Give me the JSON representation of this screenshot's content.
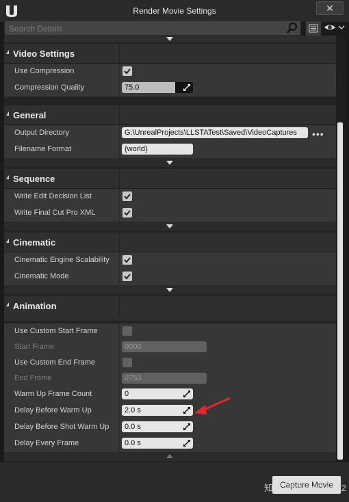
{
  "window": {
    "title": "Render Movie Settings",
    "close_glyph": "✕"
  },
  "search": {
    "placeholder": "Search Details"
  },
  "categories": [
    {
      "label": "Video Settings"
    },
    {
      "label": "General"
    },
    {
      "label": "Sequence"
    },
    {
      "label": "Cinematic"
    },
    {
      "label": "Animation"
    }
  ],
  "video": {
    "use_compression": {
      "label": "Use Compression",
      "checked": true
    },
    "compression_quality": {
      "label": "Compression Quality",
      "value": "75.0",
      "fraction": 0.75
    }
  },
  "general": {
    "output_directory": {
      "label": "Output Directory",
      "value": "G:\\UnrealProjects\\LLSTATest\\Saved\\VideoCaptures",
      "browse": "•••"
    },
    "filename_format": {
      "label": "Filename Format",
      "value": "{world}"
    }
  },
  "sequence": {
    "edl": {
      "label": "Write Edit Decision List",
      "checked": true
    },
    "fcp": {
      "label": "Write Final Cut Pro XML",
      "checked": true
    }
  },
  "cinematic": {
    "scalability": {
      "label": "Cinematic Engine Scalability",
      "checked": true
    },
    "mode": {
      "label": "Cinematic Mode",
      "checked": true
    }
  },
  "animation": {
    "use_custom_start": {
      "label": "Use Custom Start Frame",
      "checked": false
    },
    "start_frame": {
      "label": "Start Frame",
      "value": "0000"
    },
    "use_custom_end": {
      "label": "Use Custom End Frame",
      "checked": false
    },
    "end_frame": {
      "label": "End Frame",
      "value": "0750"
    },
    "warmup_count": {
      "label": "Warm Up Frame Count",
      "value": "0"
    },
    "delay_warmup": {
      "label": "Delay Before Warm Up",
      "value": "2.0 s"
    },
    "delay_shot_warmup": {
      "label": "Delay Before Shot Warm Up",
      "value": "0.0 s"
    },
    "delay_every_frame": {
      "label": "Delay Every Frame",
      "value": "0.0 s"
    }
  },
  "footer": {
    "capture_label": "Capture Movie",
    "watermark": "知乎 @BlueGoo22"
  },
  "colors": {
    "annotation_arrow": "#e8262a",
    "scroll_thumb": "#e1e1e1"
  }
}
